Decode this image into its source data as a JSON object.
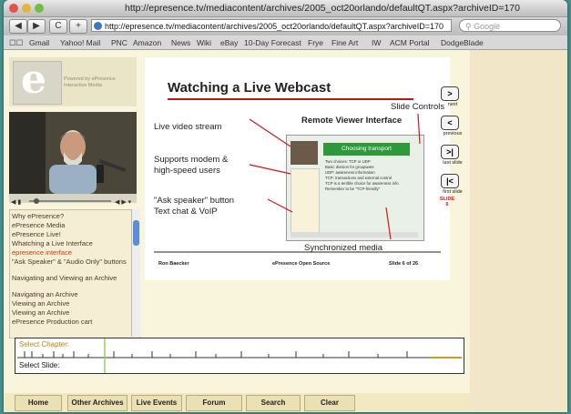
{
  "window": {
    "title": "http://epresence.tv/mediacontent/archives/2005_oct20orlando/defaultQT.aspx?archiveID=170"
  },
  "toolbar": {
    "back": "◀",
    "forward": "▶",
    "reload": "C",
    "add": "+",
    "url": "http://epresence.tv/mediacontent/archives/2005_oct20orlando/defaultQT.aspx?archiveID=170",
    "search_placeholder": "Google"
  },
  "bookmarks": [
    "Gmail",
    "Yahoo! Mail",
    "PNC",
    "Amazon",
    "News",
    "Wiki",
    "eBay",
    "10-Day Forecast",
    "Frye",
    "Fine Art",
    "IW",
    "ACM Portal",
    "DodgeBlade"
  ],
  "logo": {
    "letter": "e",
    "tagline": "Powered by ePresence Interactive Media"
  },
  "chapters": [
    "Why ePresence?",
    "ePresence Media",
    "ePresence Live!",
    "Whatching a Live Interface",
    "epresence interface",
    "\"Ask Speaker\" & \"Audio Only\" buttons",
    "Navigating and Viewing an Archive",
    "Navigating an Archive",
    "Viewing an Archive",
    "Viewing an Archive",
    "ePresence Production cart"
  ],
  "slide": {
    "title": "Watching a Live Webcast",
    "labels": {
      "live_video": "Live video stream",
      "modem": "Supports modem &\nhigh-speed users",
      "ask": "\"Ask speaker\" button\nText chat & VoIP",
      "slide_controls": "Slide Controls",
      "remote": "Remote Viewer Interface",
      "synced": "Synchronized media"
    },
    "footer": {
      "left": "Ron Baecker",
      "center": "ePresence Open Source",
      "right": "Slide 6 of 26"
    },
    "shot": {
      "heading": "Choosing transport",
      "bullets": [
        "Two choices: TCP or UDP",
        "Basic division for groupware",
        "UDP: awareness information",
        "TCP: transactions and external control",
        "TCP is a terrible choice for awareness info",
        "Remember to be \"TCP-friendly\""
      ]
    }
  },
  "slide_nav": {
    "next": "next",
    "previous": "previous",
    "last": "last slide",
    "first": "first slide",
    "current": "SLIDE 6"
  },
  "timeline": {
    "chapter_label": "Select Chapter:",
    "slide_label": "Select Slide:"
  },
  "nav": [
    "Home",
    "Other Archives",
    "Live Events",
    "Forum",
    "Search",
    "Clear"
  ]
}
